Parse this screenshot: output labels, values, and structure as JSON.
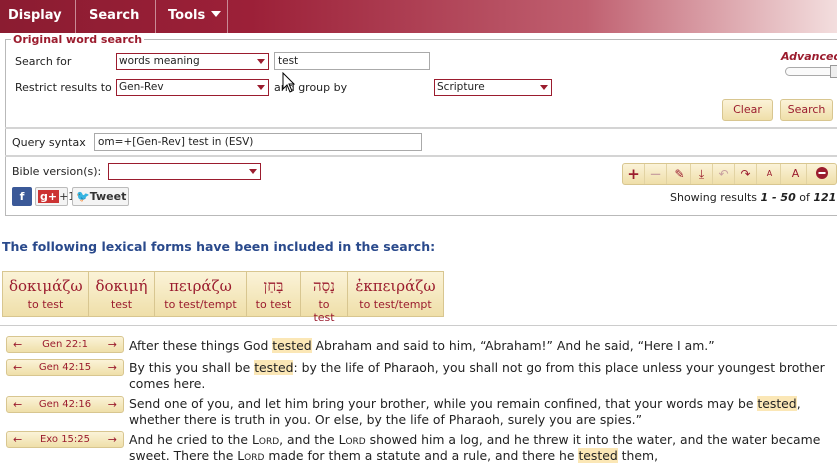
{
  "menu": {
    "display": "Display",
    "search": "Search",
    "tools": "Tools"
  },
  "search": {
    "legend": "Original word search",
    "search_for_label": "Search for",
    "search_type": "words meaning",
    "term": "test",
    "restrict_label": "Restrict results to",
    "restrict_value": "Gen-Rev",
    "group_by_label": "and group by",
    "group_by_value": "Scripture",
    "advanced_label": "Advanced",
    "clear_label": "Clear",
    "search_label": "Search",
    "query_label": "Query syntax",
    "query_value": "om=+[Gen-Rev] test in (ESV)",
    "versions_label": "Bible version(s):",
    "versions_value": ""
  },
  "social": {
    "facebook": "f",
    "google": "+1",
    "tweet": "Tweet"
  },
  "results": {
    "prefix": "Showing results ",
    "range": "1 - 50",
    "of": " of ",
    "total": "121"
  },
  "heading": "The following lexical forms have been included in the search:",
  "lexical_forms": [
    {
      "word": "δοκιμάζω",
      "meaning": "to test"
    },
    {
      "word": "δοκιμή",
      "meaning": "test"
    },
    {
      "word": "πειράζω",
      "meaning": "to test/tempt"
    },
    {
      "word": "בָּחַן",
      "meaning": "to test"
    },
    {
      "word": "נָסָה",
      "meaning": "to test"
    },
    {
      "word": "ἐκπειράζω",
      "meaning": "to test/tempt"
    }
  ],
  "verses": [
    {
      "ref": "Gen 22:1"
    },
    {
      "ref": "Gen 42:15"
    },
    {
      "ref": "Gen 42:16"
    },
    {
      "ref": "Exo 15:25"
    }
  ],
  "verse_text": {
    "v1": {
      "a": "After these things God ",
      "hl": "tested",
      "b": " Abraham and said to him, “Abraham!” And he said, “Here I am.”"
    },
    "v2": {
      "a": "By this you shall be ",
      "hl": "tested",
      "b": ": by the life of Pharaoh, you shall not go from this place unless your youngest brother comes here."
    },
    "v3": {
      "a": "Send one of you, and let him bring your brother, while you remain confined, that your words may be ",
      "hl": "tested",
      "b": ", whether there is truth in you. Or else, by the life of Pharaoh, surely you are spies.”"
    },
    "v4": {
      "a": "And he cried to the ",
      "lord1": "Lord",
      "b": ", and the ",
      "lord2": "Lord",
      "c": " showed him a log, and he threw it into the water, and the water became sweet. There the ",
      "lord3": "Lord",
      "d": " made for them a statute and a rule, and there he ",
      "hl": "tested",
      "e": " them,"
    }
  },
  "colors": {
    "accent": "#9b1c2e",
    "menu_bg": "#9c2038",
    "highlight": "#fbe7b6",
    "heading": "#2a4a8c"
  }
}
